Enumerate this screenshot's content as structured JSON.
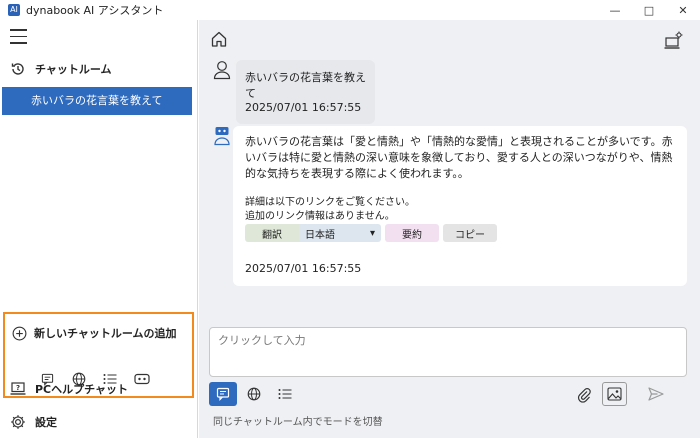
{
  "window": {
    "title": "dynabook AI アシスタント",
    "app_icon": "AI",
    "minimize": "—",
    "maximize": "□",
    "close": "✕"
  },
  "sidebar": {
    "chatroom_label": "チャットルーム",
    "active_room": "赤いバラの花言葉を教えて",
    "new_room_label": "新しいチャットルームの追加",
    "mode_icons": [
      "chat-icon",
      "globe-icon",
      "list-icon",
      "robot-icon"
    ],
    "pc_help_label": "PCヘルプチャット",
    "settings_label": "設定"
  },
  "chat": {
    "user_message": {
      "text": "赤いバラの花言葉を教えて",
      "timestamp": "2025/07/01 16:57:55"
    },
    "ai_message": {
      "text": "赤いバラの花言葉は「愛と情熱」や「情熱的な愛情」と表現されることが多いです。赤いバラは特に愛と情熱の深い意味を象徴しており、愛する人との深いつながりや、情熱的な気持ちを表現する際によく使われます。。",
      "detail_line1": "詳細は以下のリンクをご覧ください。",
      "detail_line2": "追加のリンク情報はありません。",
      "translate_label": "翻訳",
      "language_value": "日本語",
      "summary_label": "要約",
      "copy_label": "コピー",
      "timestamp": "2025/07/01 16:57:55"
    }
  },
  "input": {
    "placeholder": "クリックして入力",
    "mode_hint": "同じチャットルーム内でモードを切替"
  },
  "colors": {
    "accent": "#2e6bbf",
    "highlight_border": "#f28a1e"
  }
}
